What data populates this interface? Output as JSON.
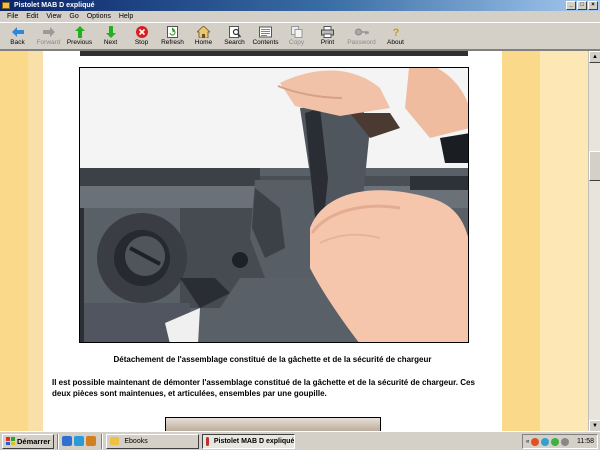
{
  "window": {
    "title": "Pistolet MAB D expliqué"
  },
  "menu": [
    "File",
    "Edit",
    "View",
    "Go",
    "Options",
    "Help"
  ],
  "toolbar": {
    "buttons": [
      {
        "label": "Back",
        "icon": "back-arrow-icon",
        "enabled": true
      },
      {
        "label": "Forward",
        "icon": "forward-arrow-icon",
        "enabled": false
      },
      {
        "label": "Previous",
        "icon": "previous-arrow-icon",
        "enabled": true
      },
      {
        "label": "Next",
        "icon": "next-arrow-icon",
        "enabled": true
      },
      {
        "label": "Stop",
        "icon": "stop-icon",
        "enabled": true
      },
      {
        "label": "Refresh",
        "icon": "refresh-icon",
        "enabled": true
      },
      {
        "label": "Home",
        "icon": "home-icon",
        "enabled": true
      },
      {
        "label": "Search",
        "icon": "search-icon",
        "enabled": true
      },
      {
        "label": "Contents",
        "icon": "contents-icon",
        "enabled": true
      },
      {
        "label": "Copy",
        "icon": "copy-icon",
        "enabled": false
      },
      {
        "label": "Print",
        "icon": "print-icon",
        "enabled": true
      },
      {
        "label": "Password",
        "icon": "password-key-icon",
        "enabled": false
      },
      {
        "label": "About",
        "icon": "about-icon",
        "enabled": true
      }
    ]
  },
  "page": {
    "caption": "Détachement de l'assemblage constitué de la gâchette et de la sécurité de chargeur",
    "paragraph": "Il est possible maintenant de démonter l'assemblage constitué de la gâchette et de la sécurité de chargeur. Ces deux pièces sont maintenues, et articulées, ensembles par une goupille."
  },
  "taskbar": {
    "start_label": "Démarrer",
    "tasks": [
      {
        "label": "Ebooks",
        "active": false
      },
      {
        "label": "Pistolet MAB D expliqué",
        "active": true
      }
    ],
    "clock": "11:58"
  },
  "colors": {
    "page_stripe": "#fbd98a",
    "page_background": "#f8e0a8",
    "titlebar": "#0a246a"
  }
}
